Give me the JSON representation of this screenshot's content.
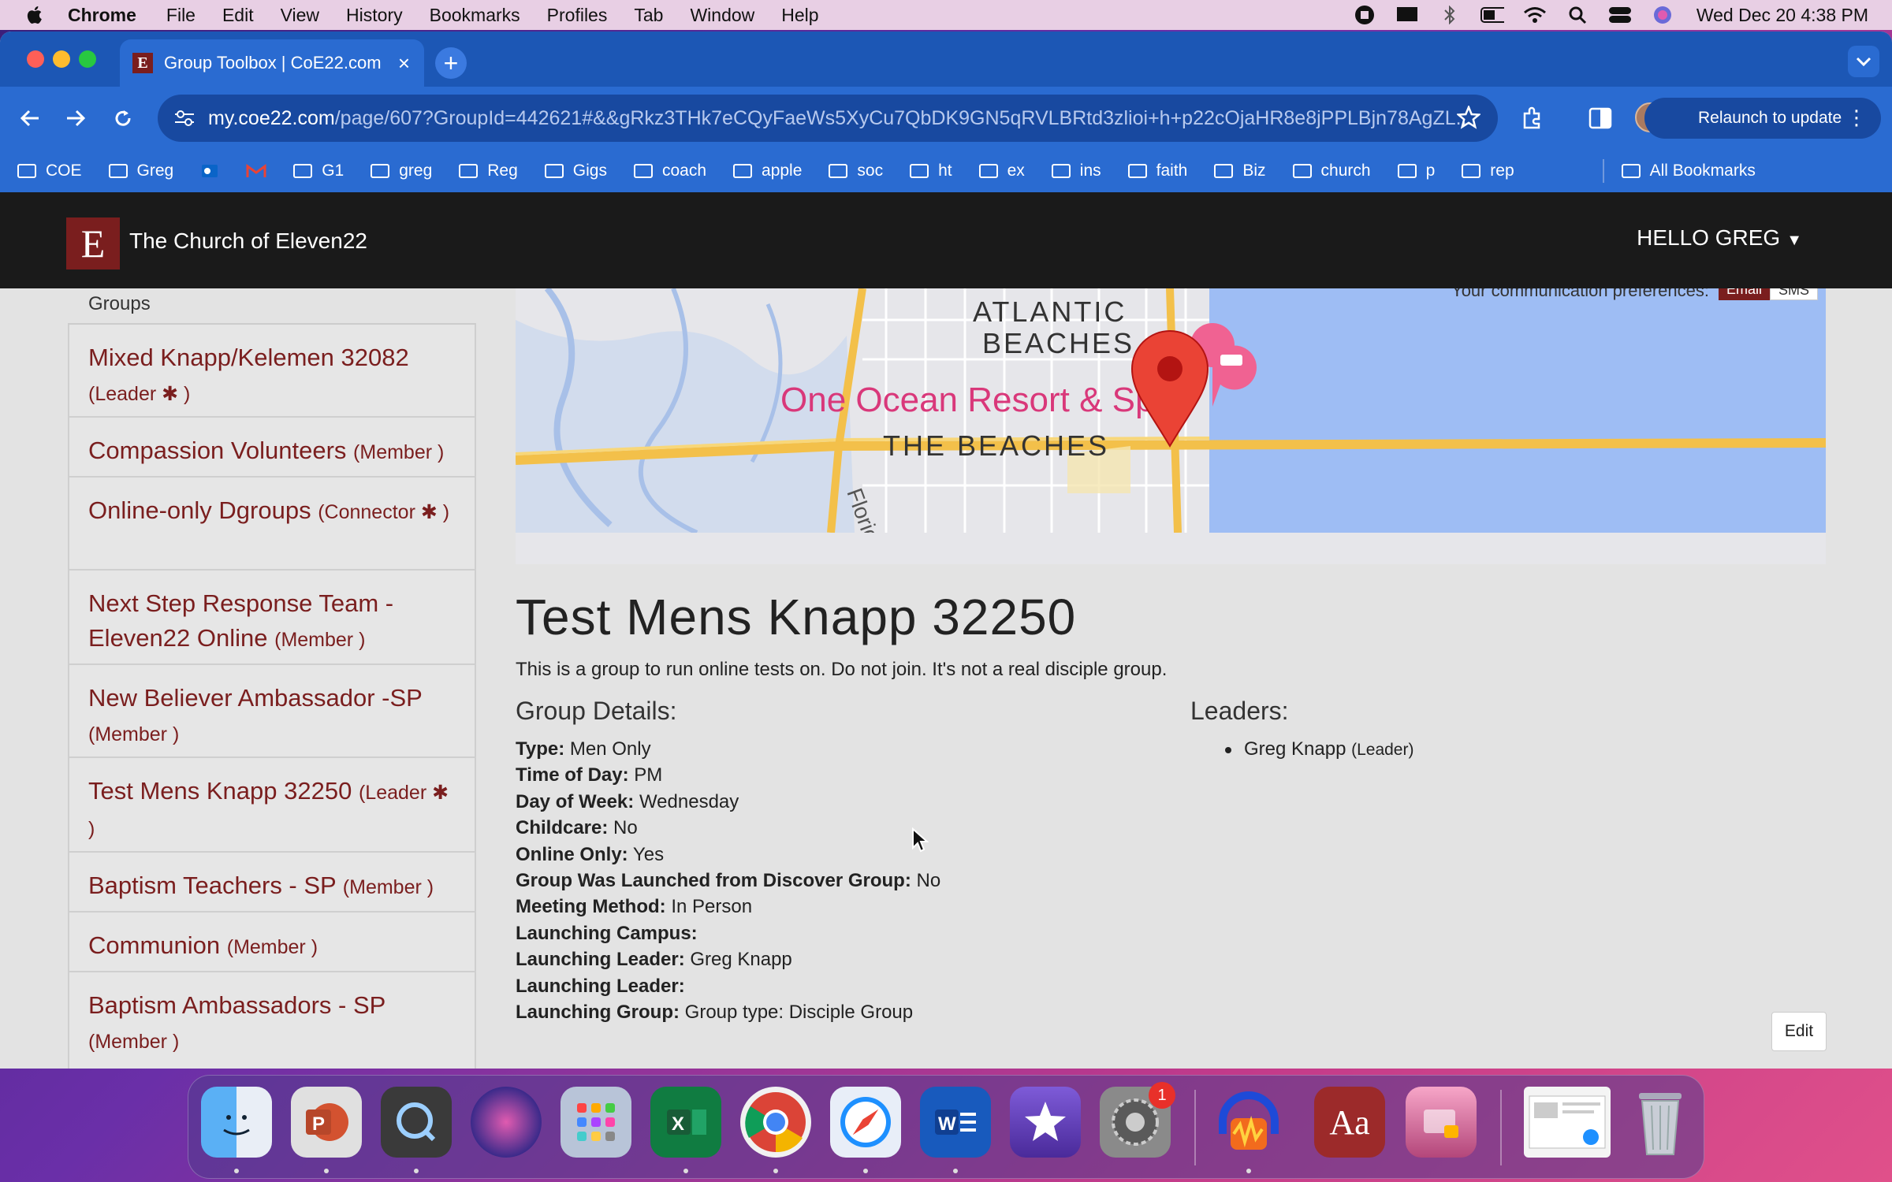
{
  "menubar": {
    "app": "Chrome",
    "items": [
      "File",
      "Edit",
      "View",
      "History",
      "Bookmarks",
      "Profiles",
      "Tab",
      "Window",
      "Help"
    ],
    "clock": "Wed Dec 20  4:38 PM"
  },
  "browser": {
    "tab_title": "Group Toolbox | CoE22.com",
    "tab_favicon": "E",
    "url_domain": "my.coe22.com",
    "url_path": "/page/607?GroupId=442621#&&gRkz3THk7eCQyFaeWs5XyCu7QbDK9GN5qRVLBRtd3zlioi+h+p22cOjaHR8e8jPPLBjn78AgZL...",
    "relaunch_label": "Relaunch to update",
    "bookmarks": [
      "COE",
      "Greg",
      "",
      "",
      "G1",
      "greg",
      "Reg",
      "Gigs",
      "coach",
      "apple",
      "soc",
      "ht",
      "ex",
      "ins",
      "faith",
      "Biz",
      "church",
      "p",
      "rep"
    ],
    "all_bookmarks": "All Bookmarks"
  },
  "site": {
    "logo_letter": "E",
    "name": "The Church of Eleven22",
    "greeting": "HELLO GREG",
    "brand_color": "#7a1e1e"
  },
  "sidebar": {
    "header": "Groups",
    "items": [
      {
        "name": "Mixed Knapp/Kelemen 32082",
        "role": "(Leader ✱ )"
      },
      {
        "name": "Compassion Volunteers",
        "role": "(Member )"
      },
      {
        "name": "Online-only Dgroups",
        "role": "(Connector ✱ )"
      },
      {
        "name": "Next Step Response Team - Eleven22 Online",
        "role": "(Member )"
      },
      {
        "name": "New Believer Ambassador -SP",
        "role": "(Member )"
      },
      {
        "name": "Test Mens Knapp 32250",
        "role": "(Leader ✱ )"
      },
      {
        "name": "Baptism Teachers - SP",
        "role": "(Member )"
      },
      {
        "name": "Communion",
        "role": "(Member )"
      },
      {
        "name": "Baptism Ambassadors - SP",
        "role": "(Member )"
      }
    ]
  },
  "map": {
    "labels": [
      "ATLANTIC",
      "BEACHES",
      "One Ocean Resort & Sp",
      "THE BEACHES",
      "Florid"
    ],
    "comm_pref_label": "Your communication preferences:",
    "email_label": "Email",
    "sms_label": "SMS"
  },
  "group": {
    "title": "Test Mens Knapp 32250",
    "description": "This is a group to run online tests on. Do not join. It's not a real disciple group.",
    "details_heading": "Group Details:",
    "leaders_heading": "Leaders:",
    "details": [
      {
        "label": "Type:",
        "value": "Men Only"
      },
      {
        "label": "Time of Day:",
        "value": "PM"
      },
      {
        "label": "Day of Week:",
        "value": "Wednesday"
      },
      {
        "label": "Childcare:",
        "value": "No"
      },
      {
        "label": "Online Only:",
        "value": "Yes"
      },
      {
        "label": "Group Was Launched from Discover Group:",
        "value": "No"
      },
      {
        "label": "Meeting Method:",
        "value": "In Person"
      },
      {
        "label": "Launching Campus:",
        "value": ""
      },
      {
        "label": "Launching Leader:",
        "value": "Greg Knapp"
      },
      {
        "label": "Launching Leader:",
        "value": ""
      },
      {
        "label": "Launching Group:",
        "value": "Group type: Disciple Group"
      }
    ],
    "leaders": [
      {
        "name": "Greg Knapp",
        "role": "(Leader)"
      }
    ],
    "edit_label": "Edit"
  },
  "dock": {
    "apps": [
      "finder-icon",
      "powerpoint-icon",
      "quicktime-icon",
      "siri-icon",
      "launchpad-icon",
      "excel-icon",
      "chrome-icon",
      "safari-icon",
      "word-icon",
      "imovie-icon",
      "system-settings-icon",
      "audio-app-icon",
      "dictionary-icon",
      "app-icon",
      "window-preview-icon",
      "trash-icon"
    ],
    "settings_badge": "1"
  }
}
